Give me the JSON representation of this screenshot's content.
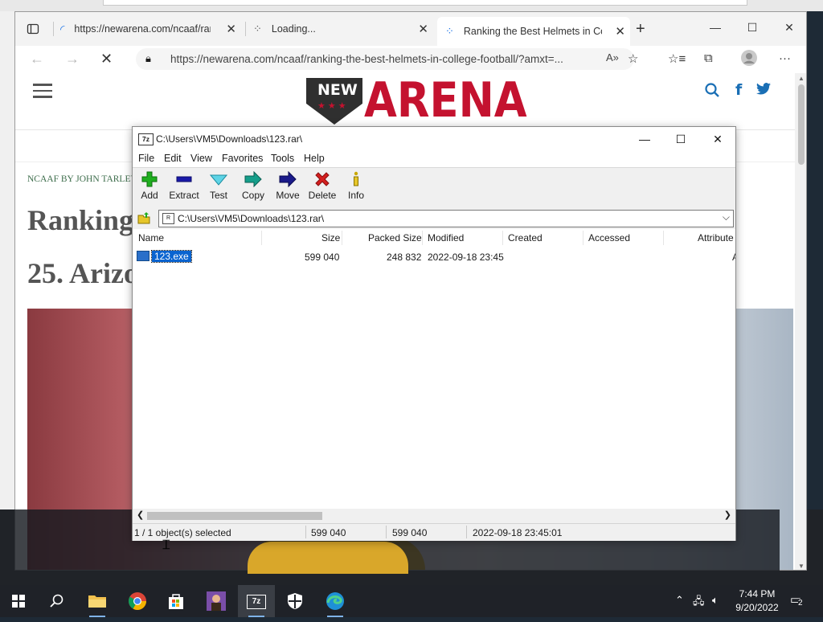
{
  "browser": {
    "tabs": [
      {
        "label": "https://newarena.com/ncaaf/ranking"
      },
      {
        "label": "Loading..."
      },
      {
        "label": "Ranking the Best Helmets in Colle"
      }
    ],
    "new_tab": "+",
    "address": "https://newarena.com/ncaaf/ranking-the-best-helmets-in-college-football/?amxt=..."
  },
  "page": {
    "logo_new": "NEW",
    "logo_stars": "★★★",
    "logo_arena": "ARENA",
    "byline": "NCAAF BY JOHN TARLEY",
    "headline": "Ranking",
    "subhead": "25. Arizo"
  },
  "zip": {
    "title": "C:\\Users\\VM5\\Downloads\\123.rar\\",
    "app_icon": "7z",
    "menu": [
      "File",
      "Edit",
      "View",
      "Favorites",
      "Tools",
      "Help"
    ],
    "tools": [
      {
        "label": "Add",
        "icon": "plus-icon",
        "color": "#1fae1f"
      },
      {
        "label": "Extract",
        "icon": "minus-icon",
        "color": "#1a1aa8"
      },
      {
        "label": "Test",
        "icon": "check-icon",
        "color": "#1ab5c9"
      },
      {
        "label": "Copy",
        "icon": "arrow-right-icon",
        "color": "#159e8a"
      },
      {
        "label": "Move",
        "icon": "arrow-right-icon",
        "color": "#1a1a8a"
      },
      {
        "label": "Delete",
        "icon": "x-icon",
        "color": "#d41f1f"
      },
      {
        "label": "Info",
        "icon": "info-icon",
        "color": "#c9a800"
      }
    ],
    "path": "C:\\Users\\VM5\\Downloads\\123.rar\\",
    "columns": [
      "Name",
      "Size",
      "Packed Size",
      "Modified",
      "Created",
      "Accessed",
      "Attribute"
    ],
    "rows": [
      {
        "name": "123.exe",
        "size": "599 040",
        "packed": "248 832",
        "modified": "2022-09-18 23:45",
        "created": "",
        "accessed": "",
        "attr": "A"
      }
    ],
    "status": {
      "selected": "1 / 1 object(s) selected",
      "size": "599 040",
      "packed": "599 040",
      "date": "2022-09-18 23:45:01"
    }
  },
  "taskbar": {
    "time": "7:44 PM",
    "date": "9/20/2022",
    "notifications": "2"
  }
}
